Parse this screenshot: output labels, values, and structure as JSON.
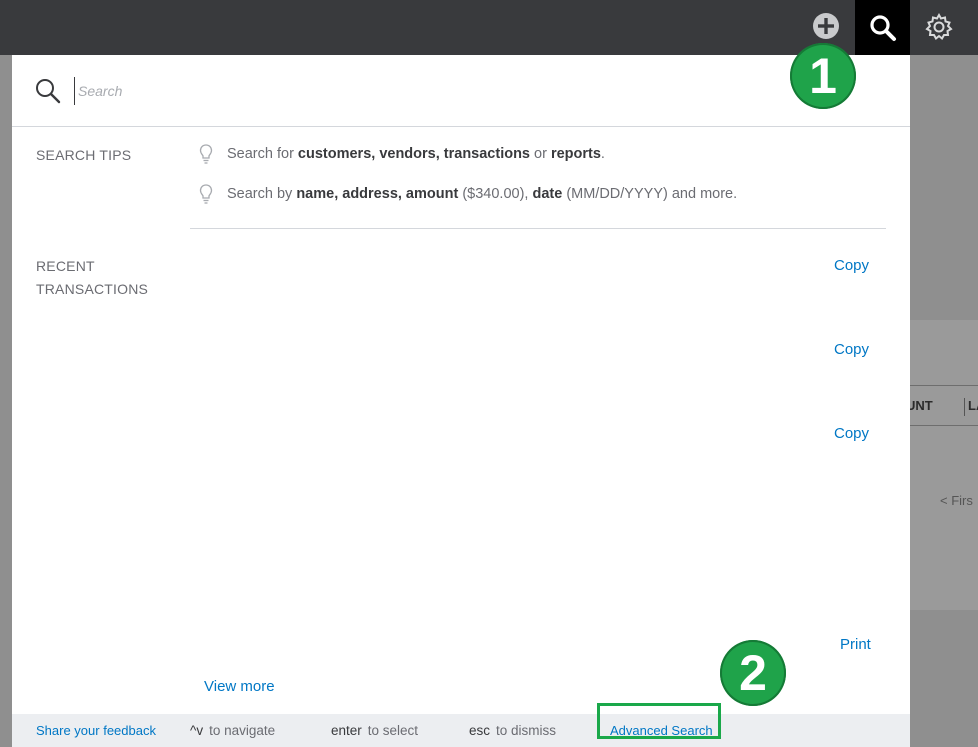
{
  "topbar": {
    "icons": [
      "plus-circle-icon",
      "search-icon",
      "gear-icon"
    ]
  },
  "background": {
    "column_amount": "UNT",
    "column_la": "LA",
    "pager": "< Firs"
  },
  "search": {
    "placeholder": "Search"
  },
  "tips": {
    "heading": "SEARCH TIPS",
    "items": [
      {
        "prefix": "Search for ",
        "bold": "customers, vendors, transactions",
        "mid": " or ",
        "bold2": "reports",
        "suffix": "."
      },
      {
        "prefix": "Search by ",
        "bold": "name, address, amount",
        "mid": " ($340.00), ",
        "bold2": "date",
        "suffix": " (MM/DD/YYYY) and more."
      }
    ]
  },
  "recent": {
    "heading_line1": "RECENT",
    "heading_line2": "TRANSACTIONS",
    "actions": [
      "Copy",
      "Copy",
      "Copy",
      "Print"
    ],
    "view_more": "View more"
  },
  "footer": {
    "feedback": "Share your feedback",
    "navigate_key": "^v",
    "navigate_text": "to navigate",
    "enter_key": "enter",
    "enter_text": "to select",
    "esc_key": "esc",
    "esc_text": "to dismiss",
    "advanced": "Advanced Search"
  },
  "callouts": [
    "1",
    "2"
  ],
  "colors": {
    "brand_link": "#0077c5",
    "callout_green": "#1fa34a",
    "topbar": "#393a3d"
  }
}
